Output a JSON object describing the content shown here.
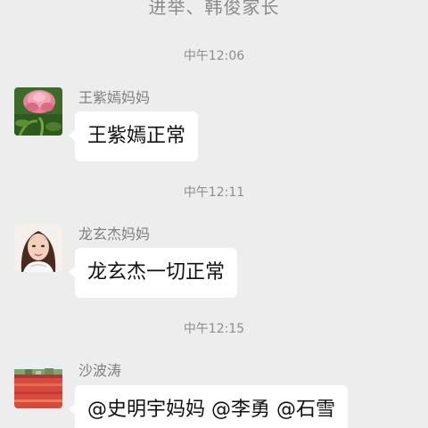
{
  "header": {
    "partial_text": "进举、韩俊家长"
  },
  "messages": [
    {
      "time": "中午12:06",
      "sender": "王紫嫣妈妈",
      "text": "王紫嫣正常",
      "avatar_icon": "pink-flower-avatar"
    },
    {
      "time": "中午12:11",
      "sender": "龙玄杰妈妈",
      "text": "龙玄杰一切正常",
      "avatar_icon": "woman-portrait-avatar"
    },
    {
      "time": "中午12:15",
      "sender": "沙波涛",
      "text": "@史明宇妈妈 @李勇 @石雪",
      "avatar_icon": "tulip-field-avatar"
    }
  ],
  "colors": {
    "background": "#ededed",
    "bubble": "#ffffff",
    "timestamp_text": "#8d8d8d",
    "sender_text": "#7f7f7f",
    "message_text": "#111111"
  }
}
